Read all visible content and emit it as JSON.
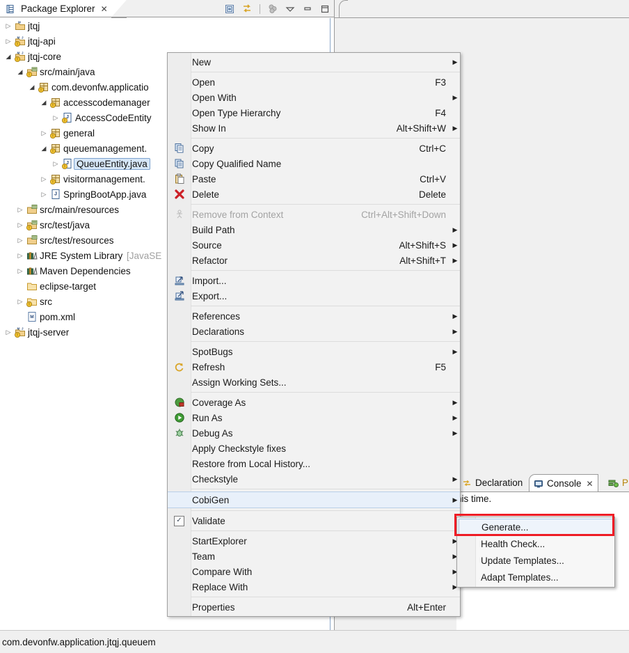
{
  "window": {
    "status_bar_text": "com.devonfw.application.jtqj.queuem"
  },
  "package_explorer": {
    "tab_label": "Package Explorer",
    "tab_close": "✕",
    "toolbar": [
      {
        "name": "collapse-all-icon",
        "title": "Collapse All"
      },
      {
        "name": "link-with-editor-icon",
        "title": "Link with Editor"
      },
      {
        "name": "view-filter-icon",
        "title": "Filters"
      },
      {
        "name": "view-menu-icon",
        "title": "View Menu"
      },
      {
        "name": "minimize-icon",
        "title": "Minimize"
      },
      {
        "name": "maximize-icon",
        "title": "Maximize"
      }
    ],
    "tree": [
      {
        "label": "jtqj",
        "indent": 0,
        "twisty": "collapsed",
        "icon": "maven-project-folder-icon",
        "selected": false
      },
      {
        "label": "jtqj-api",
        "indent": 0,
        "twisty": "collapsed",
        "icon": "maven-java-project-warning-icon",
        "selected": false
      },
      {
        "label": "jtqj-core",
        "indent": 0,
        "twisty": "expanded",
        "icon": "maven-java-project-warning-icon",
        "selected": false
      },
      {
        "label": "src/main/java",
        "indent": 1,
        "twisty": "expanded",
        "icon": "source-folder-warning-icon",
        "selected": false
      },
      {
        "label": "com.devonfw.applicatio",
        "indent": 2,
        "twisty": "expanded",
        "icon": "package-warning-icon",
        "selected": false
      },
      {
        "label": "accesscodemanager",
        "indent": 3,
        "twisty": "expanded",
        "icon": "package-warning-icon",
        "selected": false
      },
      {
        "label": "AccessCodeEntity",
        "indent": 4,
        "twisty": "collapsed",
        "icon": "java-file-warning-icon",
        "selected": false
      },
      {
        "label": "general",
        "indent": 3,
        "twisty": "collapsed",
        "icon": "package-warning-icon",
        "selected": false
      },
      {
        "label": "queuemanagement.",
        "indent": 3,
        "twisty": "expanded",
        "icon": "package-warning-icon",
        "selected": false
      },
      {
        "label": "QueueEntity.java",
        "indent": 4,
        "twisty": "collapsed",
        "icon": "java-file-warning-icon",
        "selected": true
      },
      {
        "label": "visitormanagement.",
        "indent": 3,
        "twisty": "collapsed",
        "icon": "package-warning-icon",
        "selected": false
      },
      {
        "label": "SpringBootApp.java",
        "indent": 3,
        "twisty": "collapsed",
        "icon": "java-file-icon",
        "selected": false
      },
      {
        "label": "src/main/resources",
        "indent": 1,
        "twisty": "collapsed",
        "icon": "resource-folder-icon",
        "selected": false
      },
      {
        "label": "src/test/java",
        "indent": 1,
        "twisty": "collapsed",
        "icon": "source-folder-warning-icon",
        "selected": false
      },
      {
        "label": "src/test/resources",
        "indent": 1,
        "twisty": "collapsed",
        "icon": "resource-folder-icon",
        "selected": false
      },
      {
        "label": "JRE System Library",
        "label_dim": " [JavaSE",
        "indent": 1,
        "twisty": "collapsed",
        "icon": "library-icon",
        "selected": false
      },
      {
        "label": "Maven Dependencies",
        "indent": 1,
        "twisty": "collapsed",
        "icon": "library-icon",
        "selected": false
      },
      {
        "label": "eclipse-target",
        "indent": 1,
        "twisty": "none",
        "icon": "plain-folder-icon",
        "selected": false
      },
      {
        "label": "src",
        "indent": 1,
        "twisty": "collapsed",
        "icon": "folder-warning-icon",
        "selected": false
      },
      {
        "label": "pom.xml",
        "indent": 1,
        "twisty": "none",
        "icon": "maven-pom-icon",
        "selected": false
      },
      {
        "label": "jtqj-server",
        "indent": 0,
        "twisty": "collapsed",
        "icon": "maven-java-project-warning-icon",
        "selected": false
      }
    ]
  },
  "bottom_view": {
    "tabs": [
      {
        "label": "Declaration",
        "icon": "declaration-icon",
        "active": false,
        "closable": false
      },
      {
        "label": "Console",
        "icon": "console-icon",
        "active": true,
        "closable": true,
        "close": "✕"
      },
      {
        "label": "P",
        "icon": "progress-icon",
        "active": false,
        "closable": false
      }
    ],
    "console_text": "his time."
  },
  "context_menu": {
    "items": [
      {
        "label": "New",
        "accel": "",
        "arrow": true,
        "icon": "",
        "type": "item"
      },
      {
        "type": "separator"
      },
      {
        "label": "Open",
        "accel": "F3",
        "arrow": false,
        "icon": "",
        "type": "item"
      },
      {
        "label": "Open With",
        "accel": "",
        "arrow": true,
        "icon": "",
        "type": "item"
      },
      {
        "label": "Open Type Hierarchy",
        "accel": "F4",
        "arrow": false,
        "icon": "",
        "type": "item"
      },
      {
        "label": "Show In",
        "accel": "Alt+Shift+W",
        "arrow": true,
        "icon": "",
        "type": "item"
      },
      {
        "type": "separator"
      },
      {
        "label": "Copy",
        "accel": "Ctrl+C",
        "arrow": false,
        "icon": "copy-icon",
        "type": "item"
      },
      {
        "label": "Copy Qualified Name",
        "accel": "",
        "arrow": false,
        "icon": "copy-qualified-name-icon",
        "type": "item"
      },
      {
        "label": "Paste",
        "accel": "Ctrl+V",
        "arrow": false,
        "icon": "paste-icon",
        "type": "item"
      },
      {
        "label": "Delete",
        "accel": "Delete",
        "arrow": false,
        "icon": "delete-icon",
        "type": "item"
      },
      {
        "type": "separator"
      },
      {
        "label": "Remove from Context",
        "accel": "Ctrl+Alt+Shift+Down",
        "arrow": false,
        "icon": "remove-from-context-icon",
        "type": "item",
        "disabled": true
      },
      {
        "label": "Build Path",
        "accel": "",
        "arrow": true,
        "icon": "",
        "type": "item"
      },
      {
        "label": "Source",
        "accel": "Alt+Shift+S",
        "arrow": true,
        "icon": "",
        "type": "item"
      },
      {
        "label": "Refactor",
        "accel": "Alt+Shift+T",
        "arrow": true,
        "icon": "",
        "type": "item"
      },
      {
        "type": "separator"
      },
      {
        "label": "Import...",
        "accel": "",
        "arrow": false,
        "icon": "import-icon",
        "type": "item"
      },
      {
        "label": "Export...",
        "accel": "",
        "arrow": false,
        "icon": "export-icon",
        "type": "item"
      },
      {
        "type": "separator"
      },
      {
        "label": "References",
        "accel": "",
        "arrow": true,
        "icon": "",
        "type": "item"
      },
      {
        "label": "Declarations",
        "accel": "",
        "arrow": true,
        "icon": "",
        "type": "item"
      },
      {
        "type": "separator"
      },
      {
        "label": "SpotBugs",
        "accel": "",
        "arrow": true,
        "icon": "",
        "type": "item"
      },
      {
        "label": "Refresh",
        "accel": "F5",
        "arrow": false,
        "icon": "refresh-icon",
        "type": "item"
      },
      {
        "label": "Assign Working Sets...",
        "accel": "",
        "arrow": false,
        "icon": "",
        "type": "item"
      },
      {
        "type": "separator"
      },
      {
        "label": "Coverage As",
        "accel": "",
        "arrow": true,
        "icon": "coverage-icon",
        "type": "item"
      },
      {
        "label": "Run As",
        "accel": "",
        "arrow": true,
        "icon": "run-icon",
        "type": "item"
      },
      {
        "label": "Debug As",
        "accel": "",
        "arrow": true,
        "icon": "debug-icon",
        "type": "item"
      },
      {
        "label": "Apply Checkstyle fixes",
        "accel": "",
        "arrow": false,
        "icon": "",
        "type": "item"
      },
      {
        "label": "Restore from Local History...",
        "accel": "",
        "arrow": false,
        "icon": "",
        "type": "item"
      },
      {
        "label": "Checkstyle",
        "accel": "",
        "arrow": true,
        "icon": "",
        "type": "item"
      },
      {
        "type": "separator"
      },
      {
        "label": "CobiGen",
        "accel": "",
        "arrow": true,
        "icon": "",
        "type": "item",
        "highlight": true
      },
      {
        "type": "separator"
      },
      {
        "label": "Validate",
        "accel": "",
        "arrow": false,
        "icon": "checkbox-checked-icon",
        "type": "item",
        "checked": true
      },
      {
        "type": "separator"
      },
      {
        "label": "StartExplorer",
        "accel": "",
        "arrow": true,
        "icon": "",
        "type": "item"
      },
      {
        "label": "Team",
        "accel": "",
        "arrow": true,
        "icon": "",
        "type": "item"
      },
      {
        "label": "Compare With",
        "accel": "",
        "arrow": true,
        "icon": "",
        "type": "item"
      },
      {
        "label": "Replace With",
        "accel": "",
        "arrow": true,
        "icon": "",
        "type": "item"
      },
      {
        "type": "separator"
      },
      {
        "label": "Properties",
        "accel": "Alt+Enter",
        "arrow": false,
        "icon": "",
        "type": "item"
      }
    ]
  },
  "cobigen_submenu": {
    "items": [
      {
        "label": "Generate...",
        "selected": true
      },
      {
        "label": "Health Check...",
        "selected": false
      },
      {
        "label": "Update Templates...",
        "selected": false
      },
      {
        "label": "Adapt Templates...",
        "selected": false
      }
    ]
  },
  "colors": {
    "highlight_border": "#ee1c25",
    "menu_bg": "#f2f2f2",
    "selection_bg": "#d6e6f7",
    "tree_selection_border": "#7da2ce"
  }
}
